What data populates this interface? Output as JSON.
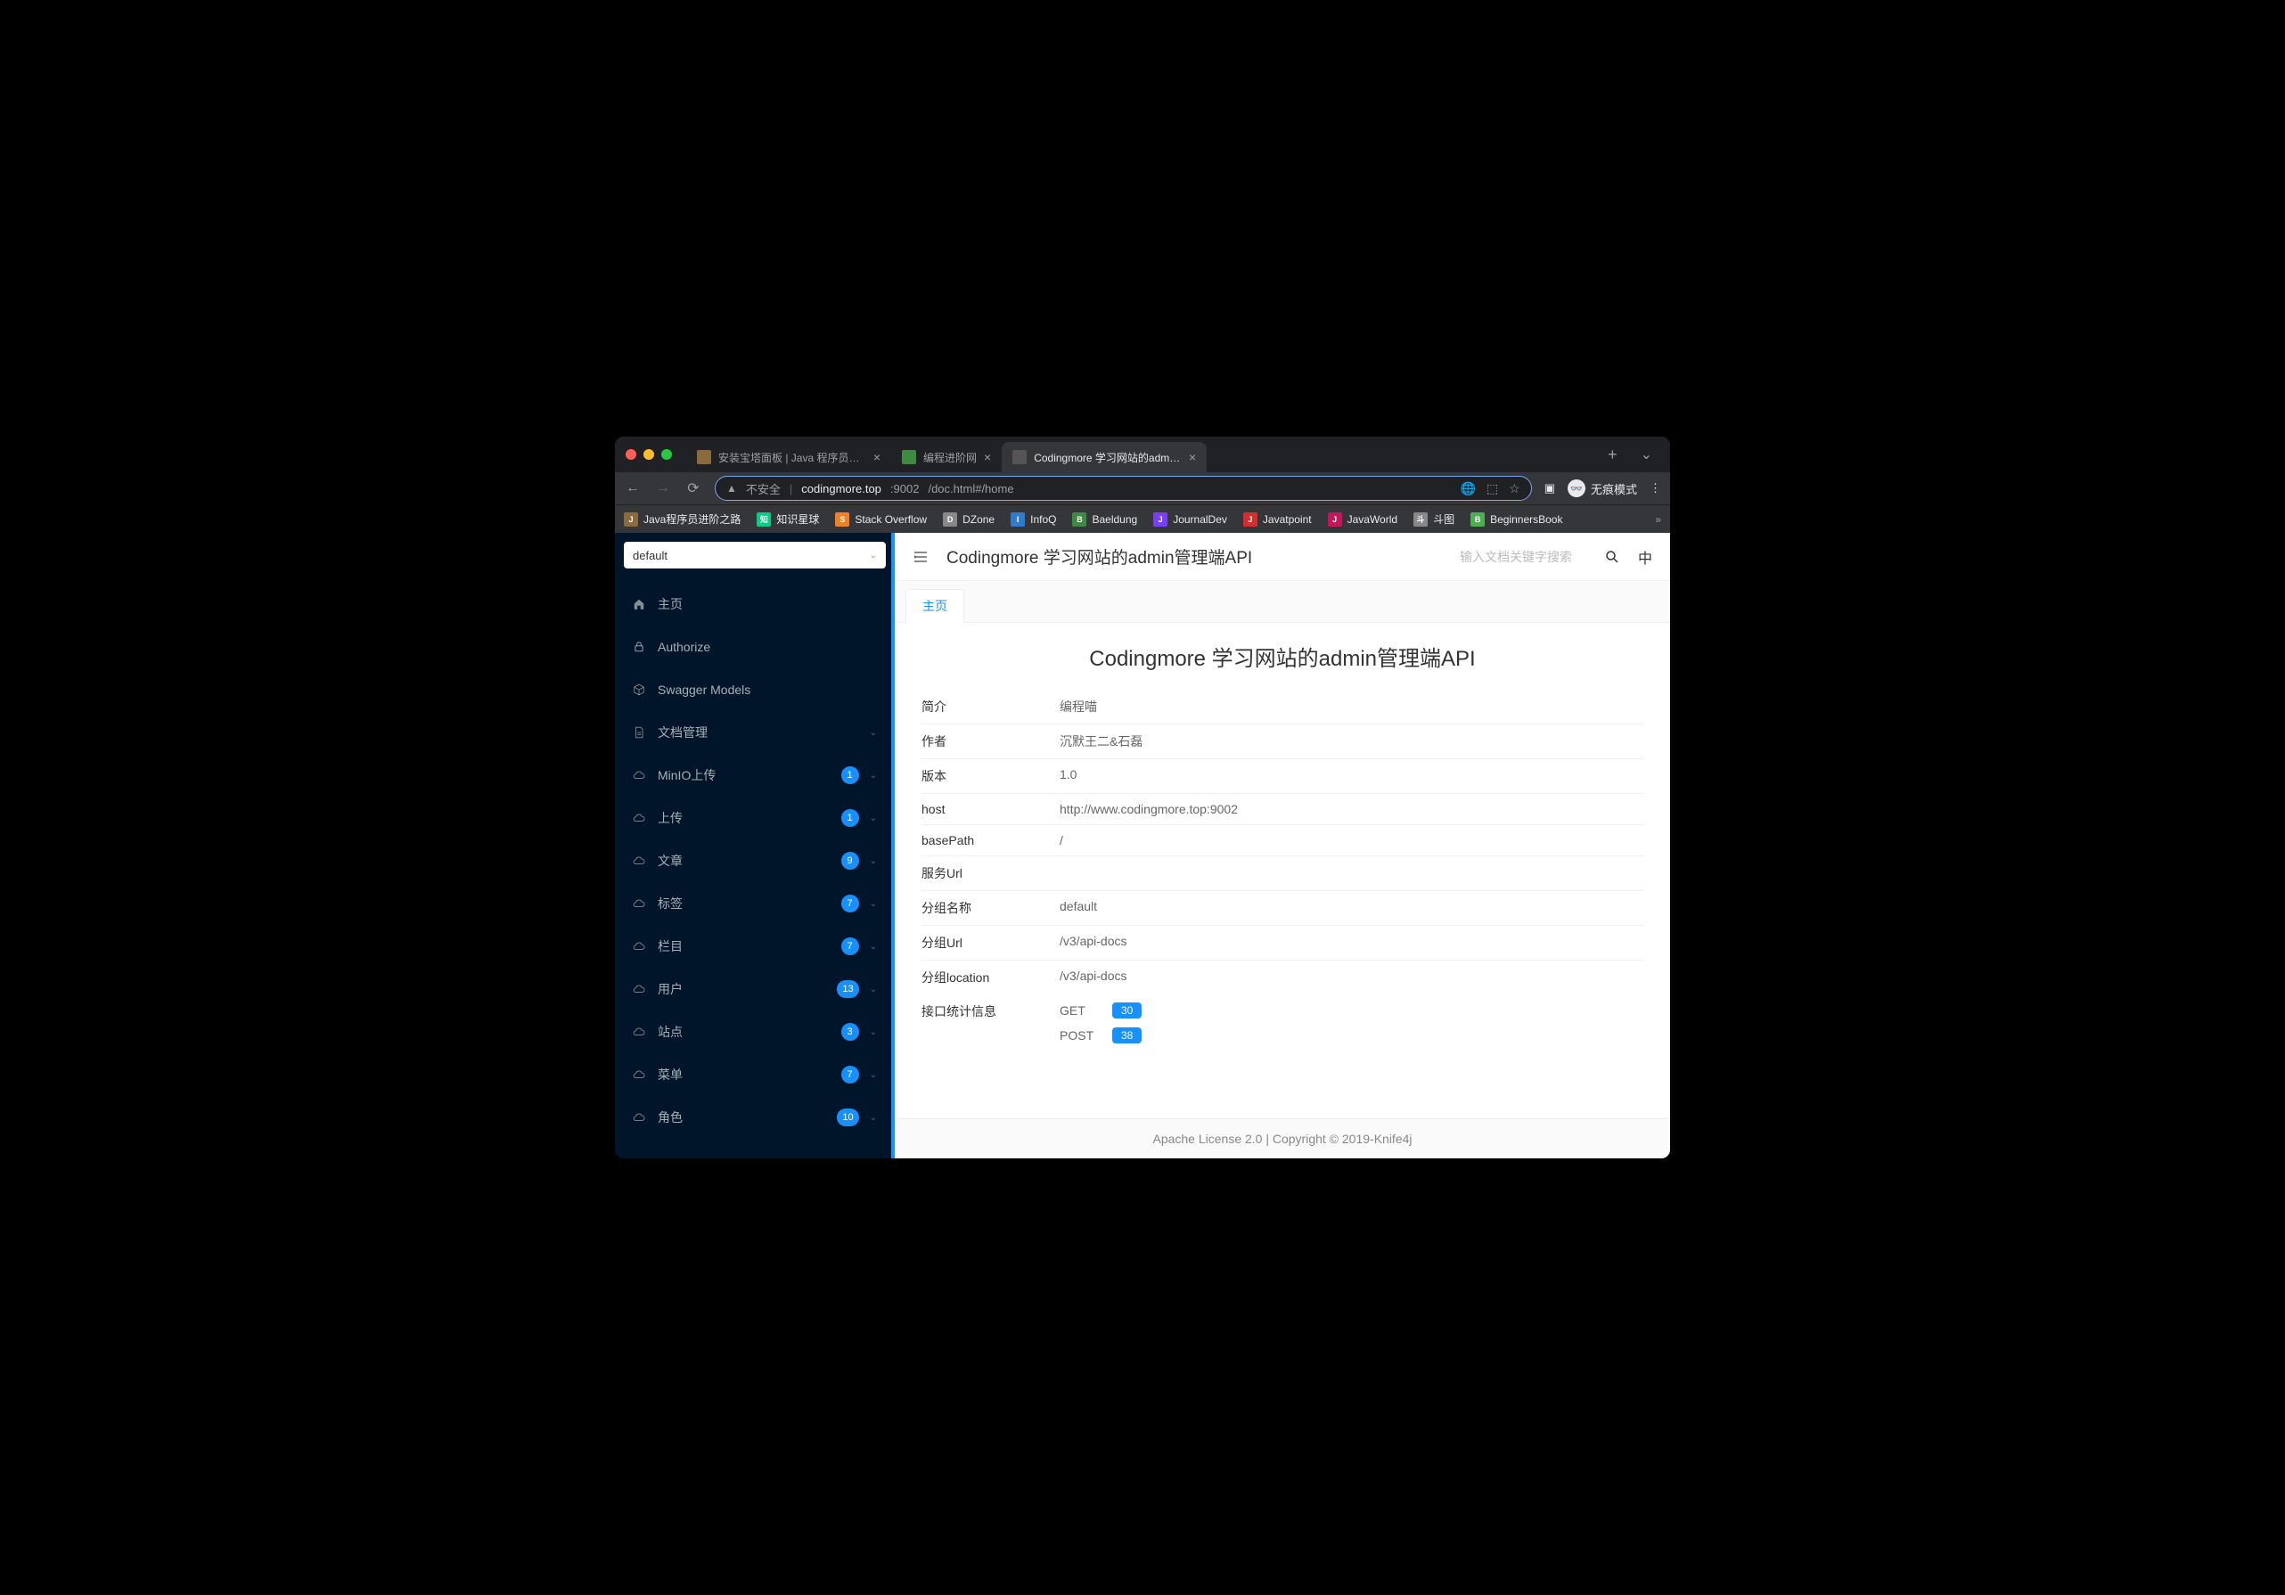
{
  "browser": {
    "tabs": [
      {
        "title": "安装宝塔面板 | Java 程序员进阶",
        "active": false,
        "favcolor": "#8b6b3e"
      },
      {
        "title": "编程进阶网",
        "active": false,
        "favcolor": "#3d8b40"
      },
      {
        "title": "Codingmore 学习网站的admin管",
        "active": true,
        "favcolor": "#555"
      }
    ],
    "url_insecure": "不安全",
    "url_host": "codingmore.top",
    "url_port": ":9002",
    "url_path": "/doc.html#/home",
    "incognito": "无痕模式"
  },
  "bookmarks": [
    {
      "label": "Java程序员进阶之路",
      "color": "#8b6b3e"
    },
    {
      "label": "知识星球",
      "color": "#00d084"
    },
    {
      "label": "Stack Overflow",
      "color": "#f48024"
    },
    {
      "label": "DZone",
      "color": "#888"
    },
    {
      "label": "InfoQ",
      "color": "#2e7bcf"
    },
    {
      "label": "Baeldung",
      "color": "#3d8b40"
    },
    {
      "label": "JournalDev",
      "color": "#7b3ff2"
    },
    {
      "label": "Javatpoint",
      "color": "#d32f2f"
    },
    {
      "label": "JavaWorld",
      "color": "#c2185b"
    },
    {
      "label": "斗图",
      "color": "#888"
    },
    {
      "label": "BeginnersBook",
      "color": "#4caf50"
    }
  ],
  "sidebar": {
    "select_value": "default",
    "items": [
      {
        "icon": "home",
        "label": "主页",
        "badge": null,
        "expandable": false
      },
      {
        "icon": "lock",
        "label": "Authorize",
        "badge": null,
        "expandable": false
      },
      {
        "icon": "cube",
        "label": "Swagger Models",
        "badge": null,
        "expandable": false
      },
      {
        "icon": "doc",
        "label": "文档管理",
        "badge": null,
        "expandable": true
      },
      {
        "icon": "cloud",
        "label": "MinIO上传",
        "badge": "1",
        "expandable": true
      },
      {
        "icon": "cloud",
        "label": "上传",
        "badge": "1",
        "expandable": true
      },
      {
        "icon": "cloud",
        "label": "文章",
        "badge": "9",
        "expandable": true
      },
      {
        "icon": "cloud",
        "label": "标签",
        "badge": "7",
        "expandable": true
      },
      {
        "icon": "cloud",
        "label": "栏目",
        "badge": "7",
        "expandable": true
      },
      {
        "icon": "cloud",
        "label": "用户",
        "badge": "13",
        "expandable": true
      },
      {
        "icon": "cloud",
        "label": "站点",
        "badge": "3",
        "expandable": true
      },
      {
        "icon": "cloud",
        "label": "菜单",
        "badge": "7",
        "expandable": true
      },
      {
        "icon": "cloud",
        "label": "角色",
        "badge": "10",
        "expandable": true
      }
    ]
  },
  "header": {
    "title": "Codingmore 学习网站的admin管理端API",
    "search_placeholder": "输入文档关键字搜索",
    "lang": "中"
  },
  "tab": {
    "label": "主页"
  },
  "page": {
    "title": "Codingmore 学习网站的admin管理端API",
    "rows": [
      {
        "key": "简介",
        "val": "编程喵"
      },
      {
        "key": "作者",
        "val": "沉默王二&石磊"
      },
      {
        "key": "版本",
        "val": "1.0"
      },
      {
        "key": "host",
        "val": "http://www.codingmore.top:9002"
      },
      {
        "key": "basePath",
        "val": "/"
      },
      {
        "key": "服务Url",
        "val": ""
      },
      {
        "key": "分组名称",
        "val": "default"
      },
      {
        "key": "分组Url",
        "val": "/v3/api-docs"
      },
      {
        "key": "分组location",
        "val": "/v3/api-docs"
      }
    ],
    "stats_label": "接口统计信息",
    "stats": [
      {
        "method": "GET",
        "count": "30"
      },
      {
        "method": "POST",
        "count": "38"
      }
    ]
  },
  "footer": "Apache License 2.0 | Copyright © 2019-Knife4j"
}
